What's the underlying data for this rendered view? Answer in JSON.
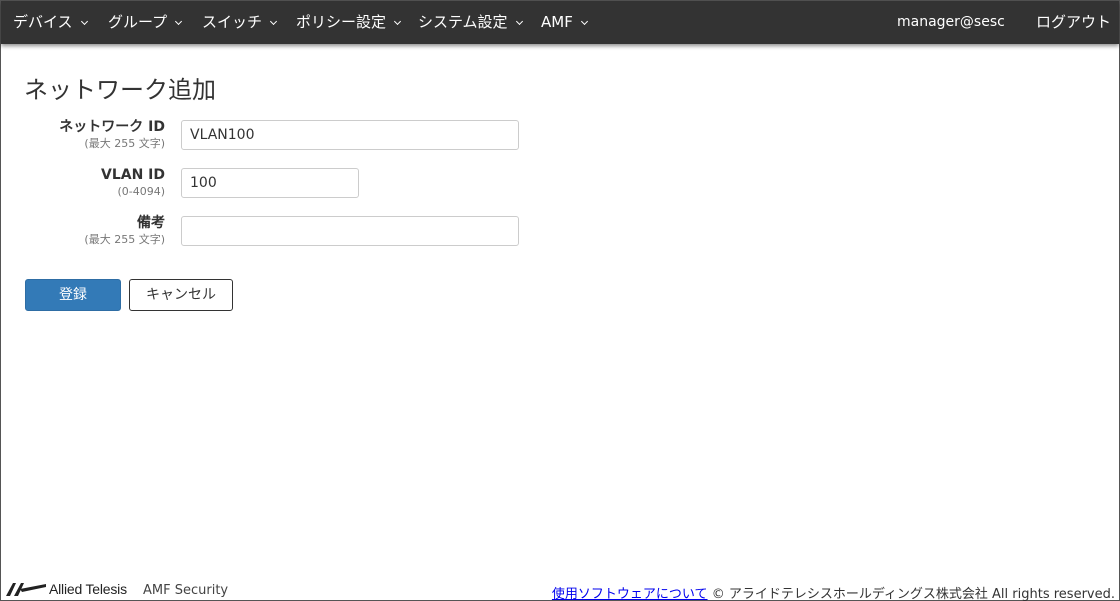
{
  "nav": {
    "items": [
      {
        "label": "デバイス"
      },
      {
        "label": "グループ"
      },
      {
        "label": "スイッチ"
      },
      {
        "label": "ポリシー設定"
      },
      {
        "label": "システム設定"
      },
      {
        "label": "AMF"
      }
    ],
    "user": "manager@sesc",
    "logout": "ログアウト"
  },
  "page": {
    "title": "ネットワーク追加"
  },
  "form": {
    "network_id": {
      "label": "ネットワーク ID",
      "hint": "(最大 255 文字)",
      "value": "VLAN100"
    },
    "vlan_id": {
      "label": "VLAN ID",
      "hint": "(0-4094)",
      "value": "100"
    },
    "note": {
      "label": "備考",
      "hint": "(最大 255 文字)",
      "value": ""
    }
  },
  "buttons": {
    "register": "登録",
    "cancel": "キャンセル"
  },
  "footer": {
    "brand": "Allied Telesis",
    "product": "AMF Security",
    "link": "使用ソフトウェアについて",
    "copyright": "© アライドテレシスホールディングス株式会社 All rights reserved."
  },
  "colors": {
    "navbar": "#333333",
    "primary": "#337ab7",
    "logo": "#222222"
  }
}
